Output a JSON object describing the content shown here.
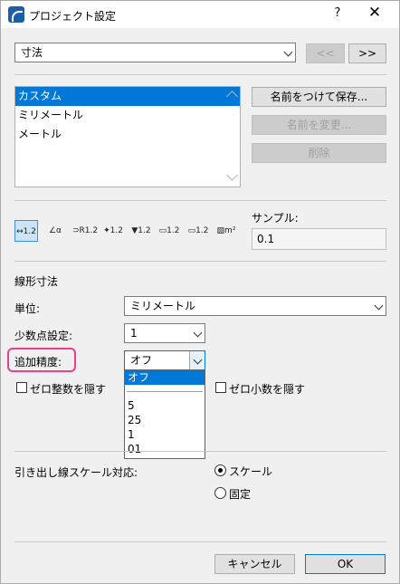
{
  "window": {
    "title": "プロジェクト設定",
    "help_label": "?",
    "close_label": "✕"
  },
  "category": {
    "selected": "寸法",
    "prev_label": "<<",
    "next_label": ">>"
  },
  "presets": {
    "items": [
      "カスタム",
      "ミリメートル",
      "メートル"
    ],
    "selected_index": 0,
    "save_label": "名前をつけて保存...",
    "rename_label": "名前を変更...",
    "delete_label": "削除"
  },
  "toolbar": {
    "tools": [
      {
        "icon": "linear-dimension-icon",
        "glyph": "↔1.2"
      },
      {
        "icon": "angle-dimension-icon",
        "glyph": "∠α"
      },
      {
        "icon": "radial-dimension-icon",
        "glyph": "⊃R1.2"
      },
      {
        "icon": "level-dimension-icon",
        "glyph": "✦1.2"
      },
      {
        "icon": "elevation-dimension-icon",
        "glyph": "▼1.2"
      },
      {
        "icon": "door-window-dimension-icon",
        "glyph": "▭1.2"
      },
      {
        "icon": "sill-height-icon",
        "glyph": "▭1.2"
      },
      {
        "icon": "area-dimension-icon",
        "glyph": "▨m²"
      }
    ],
    "selected_index": 0
  },
  "sample": {
    "label": "サンプル:",
    "value": "0.1"
  },
  "linear": {
    "section_label": "線形寸法",
    "unit_label": "単位:",
    "unit_value": "ミリメートル",
    "decimals_label": "少数点設定:",
    "decimals_value": "1",
    "precision_label": "追加精度:",
    "precision_value": "オフ",
    "precision_options_top": [
      "オフ"
    ],
    "precision_options": [
      "5",
      "25",
      "1",
      "01"
    ],
    "zero_whole_label": "ゼロ整数を隠す",
    "zero_decimal_label": "ゼロ小数を隠す"
  },
  "leader": {
    "label": "引き出し線スケール対応:",
    "option_scale": "スケール",
    "option_fixed": "固定",
    "selected": "スケール"
  },
  "footer": {
    "cancel_label": "キャンセル",
    "ok_label": "OK"
  },
  "colors": {
    "accent": "#0078d7",
    "highlight": "#e8418a"
  }
}
